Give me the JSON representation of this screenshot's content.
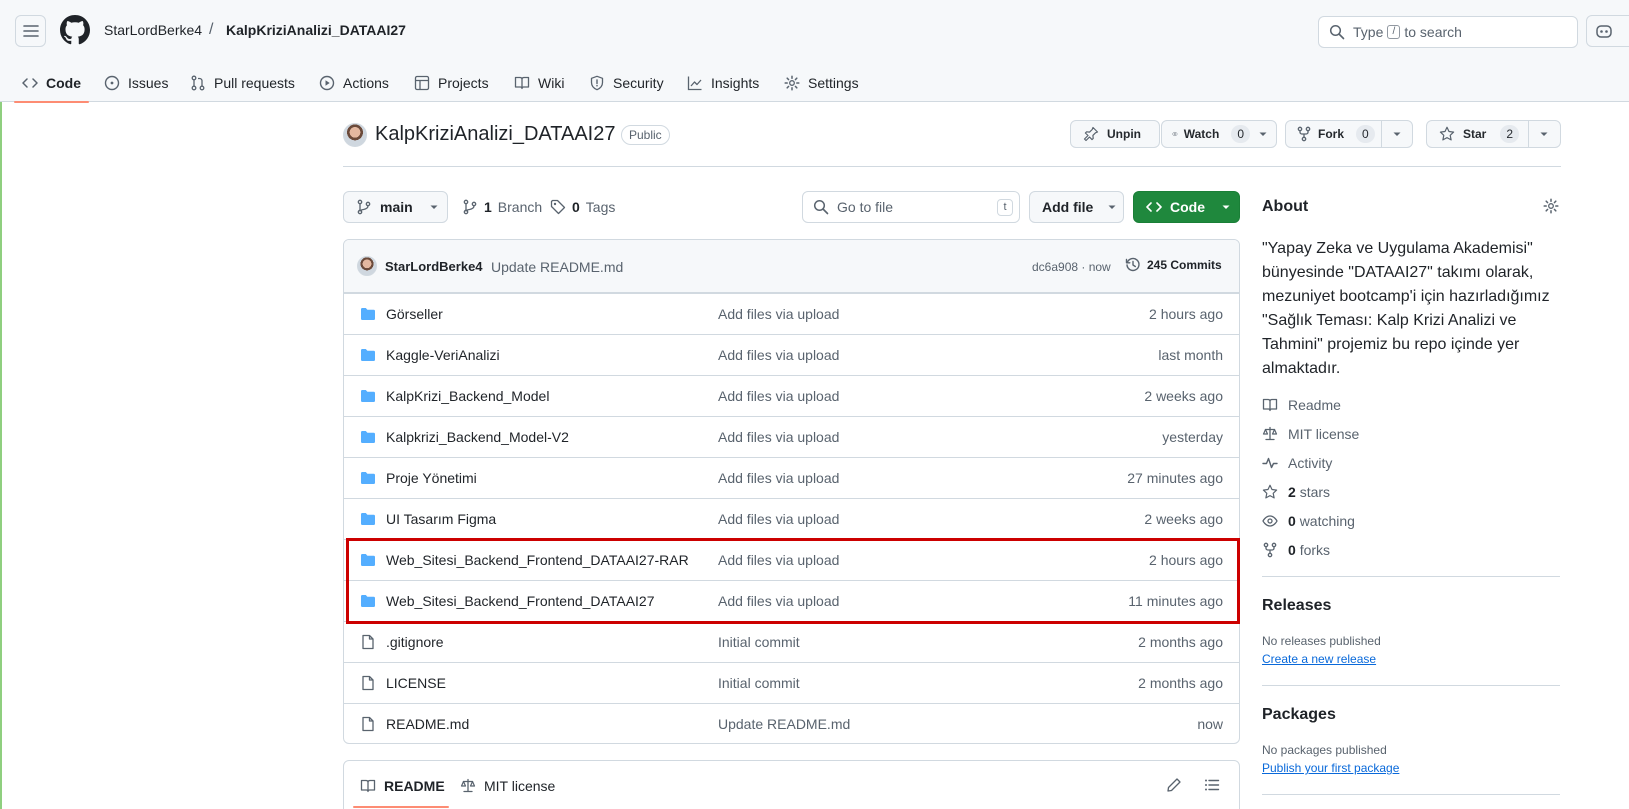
{
  "header": {
    "owner": "StarLordBerke4",
    "separator": "/",
    "repo": "KalpKriziAnalizi_DATAAI27",
    "search_prefix": "Type",
    "search_key": "/",
    "search_suffix": "to search"
  },
  "tabs": [
    {
      "label": "Code",
      "icon": "code-icon"
    },
    {
      "label": "Issues",
      "icon": "issue-icon"
    },
    {
      "label": "Pull requests",
      "icon": "pull-request-icon"
    },
    {
      "label": "Actions",
      "icon": "play-icon"
    },
    {
      "label": "Projects",
      "icon": "table-icon"
    },
    {
      "label": "Wiki",
      "icon": "book-icon"
    },
    {
      "label": "Security",
      "icon": "shield-icon"
    },
    {
      "label": "Insights",
      "icon": "graph-icon"
    },
    {
      "label": "Settings",
      "icon": "gear-icon"
    }
  ],
  "repo_header": {
    "title": "KalpKriziAnalizi_DATAAI27",
    "visibility": "Public",
    "unpin": "Unpin",
    "watch": "Watch",
    "watch_count": "0",
    "fork": "Fork",
    "fork_count": "0",
    "star": "Star",
    "star_count": "2"
  },
  "file_nav": {
    "branch": "main",
    "branch_count": "1",
    "branch_label": "Branch",
    "tag_count": "0",
    "tag_label": "Tags",
    "goto_placeholder": "Go to file",
    "goto_key": "t",
    "add_file": "Add file",
    "code": "Code"
  },
  "latest_commit": {
    "author": "StarLordBerke4",
    "message": "Update README.md",
    "hash_time": "dc6a908 · now",
    "commits": "245 Commits"
  },
  "files": [
    {
      "type": "folder",
      "name": "Görseller",
      "message": "Add files via upload",
      "age": "2 hours ago"
    },
    {
      "type": "folder",
      "name": "Kaggle-VeriAnalizi",
      "message": "Add files via upload",
      "age": "last month"
    },
    {
      "type": "folder",
      "name": "KalpKrizi_Backend_Model",
      "message": "Add files via upload",
      "age": "2 weeks ago"
    },
    {
      "type": "folder",
      "name": "Kalpkrizi_Backend_Model-V2",
      "message": "Add files via upload",
      "age": "yesterday"
    },
    {
      "type": "folder",
      "name": "Proje Yönetimi",
      "message": "Add files via upload",
      "age": "27 minutes ago"
    },
    {
      "type": "folder",
      "name": "UI Tasarım Figma",
      "message": "Add files via upload",
      "age": "2 weeks ago"
    },
    {
      "type": "folder",
      "name": "Web_Sitesi_Backend_Frontend_DATAAI27-RAR",
      "message": "Add files via upload",
      "age": "2 hours ago"
    },
    {
      "type": "folder",
      "name": "Web_Sitesi_Backend_Frontend_DATAAI27",
      "message": "Add files via upload",
      "age": "11 minutes ago"
    },
    {
      "type": "file",
      "name": ".gitignore",
      "message": "Initial commit",
      "age": "2 months ago"
    },
    {
      "type": "file",
      "name": "LICENSE",
      "message": "Initial commit",
      "age": "2 months ago"
    },
    {
      "type": "file",
      "name": "README.md",
      "message": "Update README.md",
      "age": "now"
    }
  ],
  "readme_tabs": {
    "readme": "README",
    "license": "MIT license"
  },
  "about": {
    "title": "About",
    "description": "\"Yapay Zeka ve Uygulama Akademisi\" bünyesinde \"DATAAI27\" takımı olarak, mezuniyet bootcamp'i için hazırladığımız \"Sağlık Teması: Kalp Krizi Analizi ve Tahmini\" projemiz bu repo içinde yer almaktadır.",
    "readme": "Readme",
    "license": "MIT license",
    "activity": "Activity",
    "stars_count": "2",
    "stars_label": "stars",
    "watching_count": "0",
    "watching_label": "watching",
    "forks_count": "0",
    "forks_label": "forks"
  },
  "releases": {
    "title": "Releases",
    "empty": "No releases published",
    "link": "Create a new release"
  },
  "packages": {
    "title": "Packages",
    "empty": "No packages published",
    "link": "Publish your first package"
  },
  "colors": {
    "accent_tab": "#fd8c73",
    "code_button": "#1f883d",
    "folder": "#54aeff",
    "highlight_box": "#cc0000",
    "link": "#0969da"
  }
}
